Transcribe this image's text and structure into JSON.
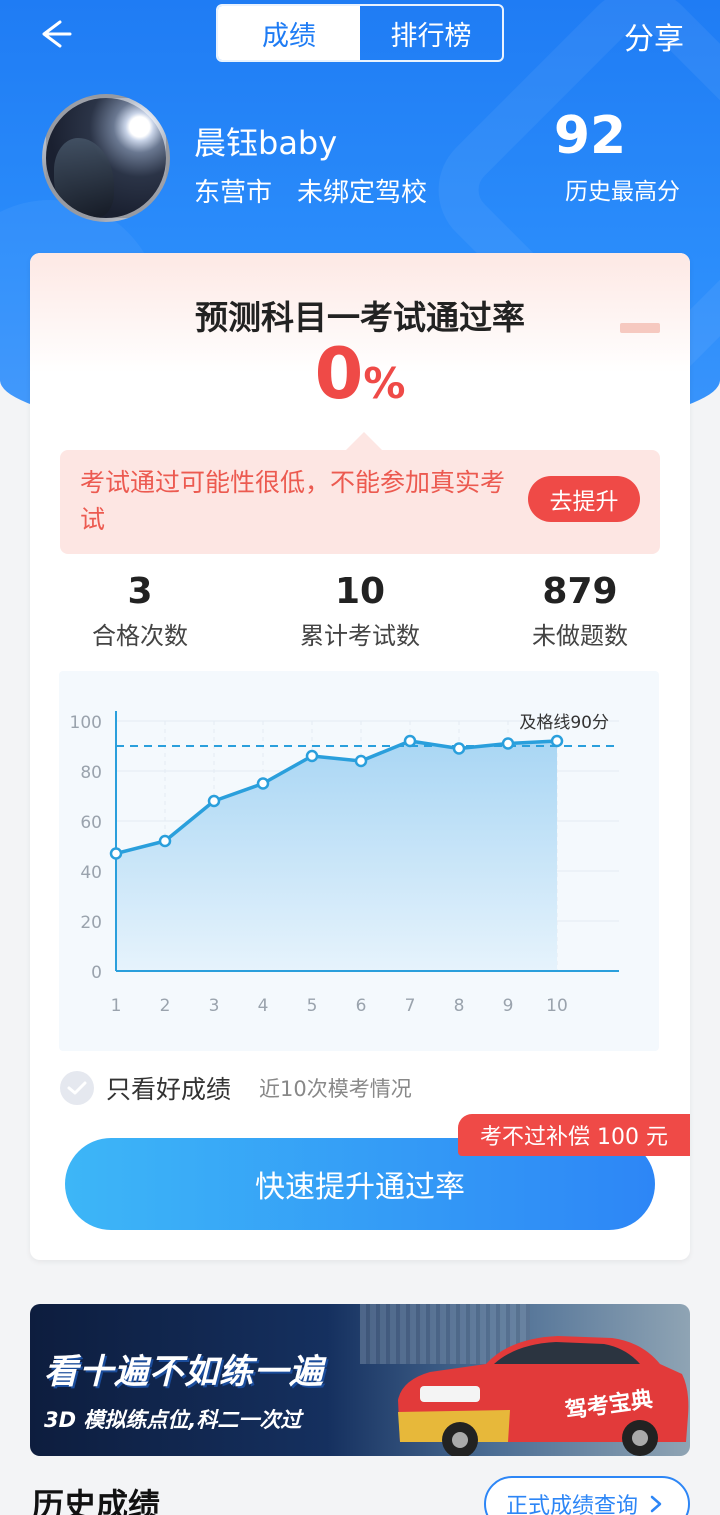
{
  "header": {
    "tabs": [
      {
        "label": "成绩",
        "active": true
      },
      {
        "label": "排行榜",
        "active": false
      }
    ],
    "share_label": "分享",
    "back_icon": "arrow-left-icon"
  },
  "profile": {
    "username": "晨钰baby",
    "city": "东营市",
    "school": "未绑定驾校",
    "best_score": "92",
    "best_score_label": "历史最高分"
  },
  "prediction": {
    "title": "预测科目一考试通过率",
    "rate_value": "0",
    "rate_unit": "%",
    "warning_text": "考试通过可能性很低，不能参加真实考试",
    "improve_label": "去提升"
  },
  "stats": [
    {
      "value": "3",
      "label": "合格次数"
    },
    {
      "value": "10",
      "label": "累计考试数"
    },
    {
      "value": "879",
      "label": "未做题数"
    }
  ],
  "chart_data": {
    "type": "area",
    "x": [
      1,
      2,
      3,
      4,
      5,
      6,
      7,
      8,
      9,
      10
    ],
    "series": [
      {
        "values": [
          47,
          52,
          68,
          75,
          86,
          84,
          92,
          89,
          91,
          92
        ]
      }
    ],
    "ylim": [
      0,
      100
    ],
    "yticks": [
      0,
      20,
      40,
      60,
      80,
      100
    ],
    "reference_line": {
      "value": 90,
      "label": "及格线90分"
    },
    "grid": true,
    "colors": {
      "line": "#2a9fdc",
      "fill_top": "#a9d6f4",
      "fill_bottom": "#e6f3fc",
      "ref": "#2a9fdc"
    }
  },
  "filter": {
    "checkbox_label": "只看好成绩",
    "note": "近10次模考情况"
  },
  "cta": {
    "label": "快速提升通过率",
    "badge": "考不过补偿 100 元"
  },
  "banner": {
    "title": "看十遍不如练一遍",
    "subtitle": "3D 模拟练点位,科二一次过",
    "car_text": "驾考宝典"
  },
  "history": {
    "title": "历史成绩",
    "link_label": "正式成绩查询"
  }
}
